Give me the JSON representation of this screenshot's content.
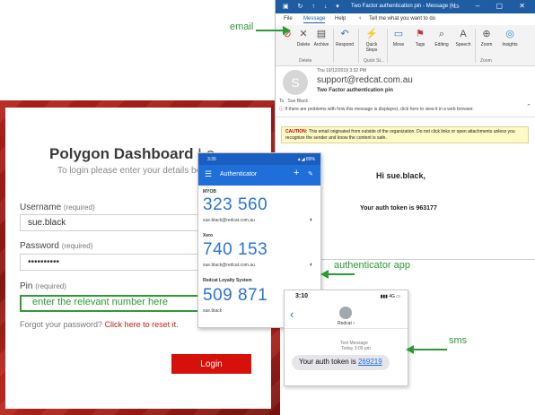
{
  "login": {
    "title_bold": "Polygon Dashboard",
    "title_rest": " Lo",
    "subtitle": "To login please enter your details be",
    "username": {
      "label": "Username",
      "req": "(required)",
      "value": "sue.black"
    },
    "password": {
      "label": "Password",
      "req": "(required)",
      "value": "••••••••••"
    },
    "pin": {
      "label": "Pin",
      "req": "(required)",
      "hint": "enter the relevant number here"
    },
    "forgot_text": "Forgot your password?",
    "forgot_link": "Click here to reset it.",
    "login_button": "Login"
  },
  "outlook": {
    "title": "Two Factor authentication pin  -  Message (H...",
    "menu": {
      "file": "File",
      "message": "Message",
      "help": "Help",
      "tell": "Tell me what you want to do"
    },
    "ribbon": {
      "delete": "Delete",
      "archive": "Archive",
      "respond": "Respond",
      "quick_steps": "Quick Steps",
      "move": "Move",
      "tags": "Tags",
      "editing": "Editing",
      "speech": "Speech",
      "zoom": "Zoom",
      "insights": "Insights",
      "group_delete": "Delete",
      "group_quick": "Quick St...",
      "group_zoom": "Zoom"
    },
    "date": "Thu 19/12/2019 3:32 PM",
    "from": "support@redcat.com.au",
    "subject": "Two Factor authentication pin",
    "to_label": "To",
    "to": "Sue Black",
    "info_bar": "If there are problems with how this message is displayed, click here to view it in a web browser.",
    "caution_label": "CAUTION:",
    "caution_text": "This email originated from outside of the organization. Do not click links or open attachments unless you recognize the sender and know the content is safe.",
    "greeting": "Hi sue.black,",
    "token_line": "Your auth token is 963177"
  },
  "authenticator": {
    "time": "3:35",
    "status_icons": "▲◢ 89%",
    "title": "Authenticator",
    "accounts": [
      {
        "name": "MYOB",
        "code": "323 560",
        "email": "sue.black@redcat.com.au"
      },
      {
        "name": "Xero",
        "code": "740 153",
        "email": "sue.black@redcat.com.au"
      },
      {
        "name": "Redcat Loyalty System",
        "code": "509 871",
        "email": "sue.black"
      }
    ]
  },
  "sms": {
    "time": "3:10",
    "status": "▮▮▮ 4G ▭",
    "contact": "Redcat",
    "kind": "Text Message",
    "when": "Today 3:09 pm",
    "message_prefix": "Your auth token is ",
    "token": "269219"
  },
  "annotations": {
    "email": "email",
    "authenticator": "authenticator app",
    "sms": "sms",
    "color": "#2b9a33"
  },
  "colors": {
    "brand_red": "#d8100a",
    "outlook_blue": "#1f5da3",
    "auth_blue": "#1e6fd9"
  }
}
